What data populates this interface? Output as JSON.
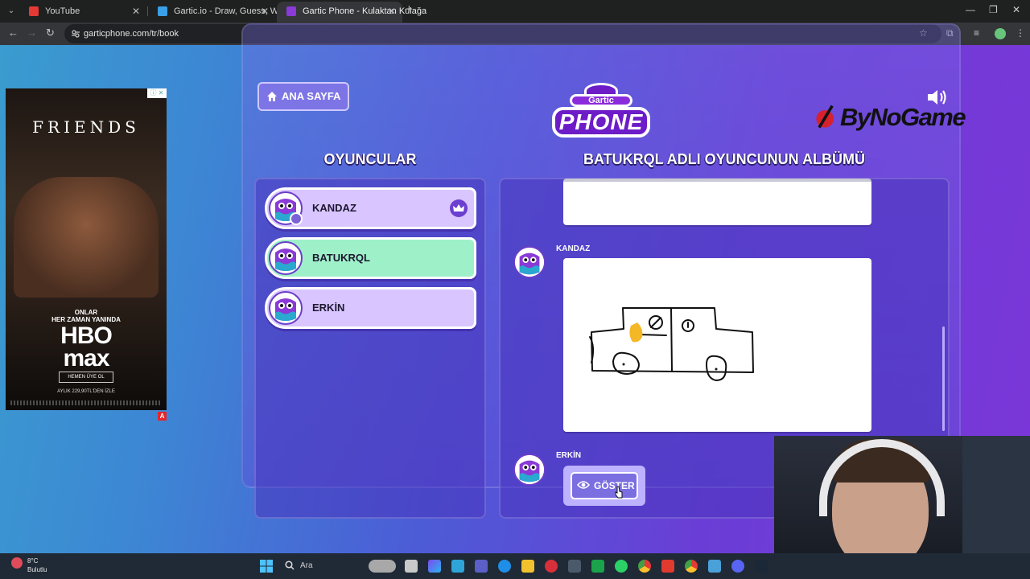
{
  "browser": {
    "tabs": [
      {
        "title": "YouTube",
        "color": "#e53935"
      },
      {
        "title": "Gartic.io - Draw, Guess, WIN",
        "color": "#3aa0e8"
      },
      {
        "title": "Gartic Phone - Kulaktan Kulağa",
        "color": "#8a3ad6"
      }
    ],
    "url": "garticphone.com/tr/book"
  },
  "ad": {
    "title": "FRIENDS",
    "line1": "ONLAR",
    "line2": "HER ZAMAN YANINDA",
    "brand1": "HBO",
    "brand2": "max",
    "cta": "HEMEN ÜYE OL",
    "price": "AYLIK 229,90TL'DEN İZLE",
    "badge": "A"
  },
  "game": {
    "home_label": "ANA SAYFA",
    "logo_top": "Gartic",
    "logo_main": "PHONE",
    "sponsor": "ByNoGame",
    "players_title": "OYUNCULAR",
    "album_title": "BATUKRQL ADLI OYUNCUNUN ALBÜMÜ",
    "players": [
      {
        "name": "KANDAZ"
      },
      {
        "name": "BATUKRQL"
      },
      {
        "name": "ERKİN"
      }
    ],
    "album": {
      "author1": "KANDAZ",
      "author2": "ERKİN",
      "show_label": "GÖSTER"
    }
  },
  "taskbar": {
    "temp": "8°C",
    "weather": "Bulutlu",
    "search": "Ara"
  },
  "colors": {
    "accent": "#7a6ee0",
    "highlight": "#9ef0c9",
    "player_bg": "#d9c5ff"
  }
}
